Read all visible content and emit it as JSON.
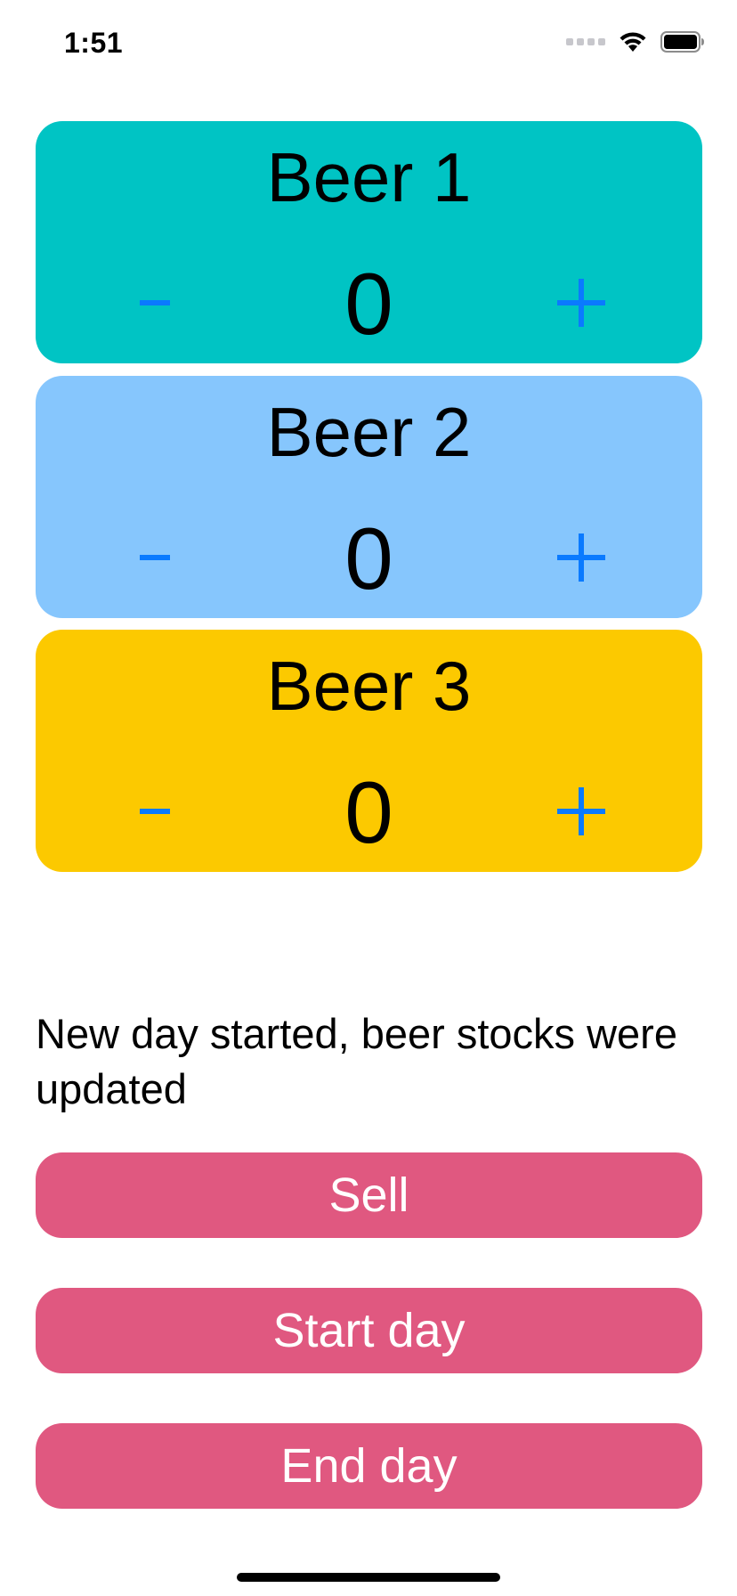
{
  "status_bar": {
    "time": "1:51",
    "icons": [
      "cellular-signal-icon",
      "wifi-icon",
      "battery-icon"
    ]
  },
  "beers": [
    {
      "name": "Beer 1",
      "count": "0",
      "minus_label": "-",
      "plus_label": "+",
      "color": "#00C4C4"
    },
    {
      "name": "Beer 2",
      "count": "0",
      "minus_label": "-",
      "plus_label": "+",
      "color": "#86C6FD"
    },
    {
      "name": "Beer 3",
      "count": "0",
      "minus_label": "-",
      "plus_label": "+",
      "color": "#FCC900"
    }
  ],
  "message": "New day started, beer stocks were updated",
  "actions": {
    "sell_label": "Sell",
    "start_day_label": "Start day",
    "end_day_label": "End day",
    "button_color": "#E05880"
  },
  "colors": {
    "accent": "#0A7AFF",
    "text": "#000000",
    "background": "#FFFFFF"
  }
}
